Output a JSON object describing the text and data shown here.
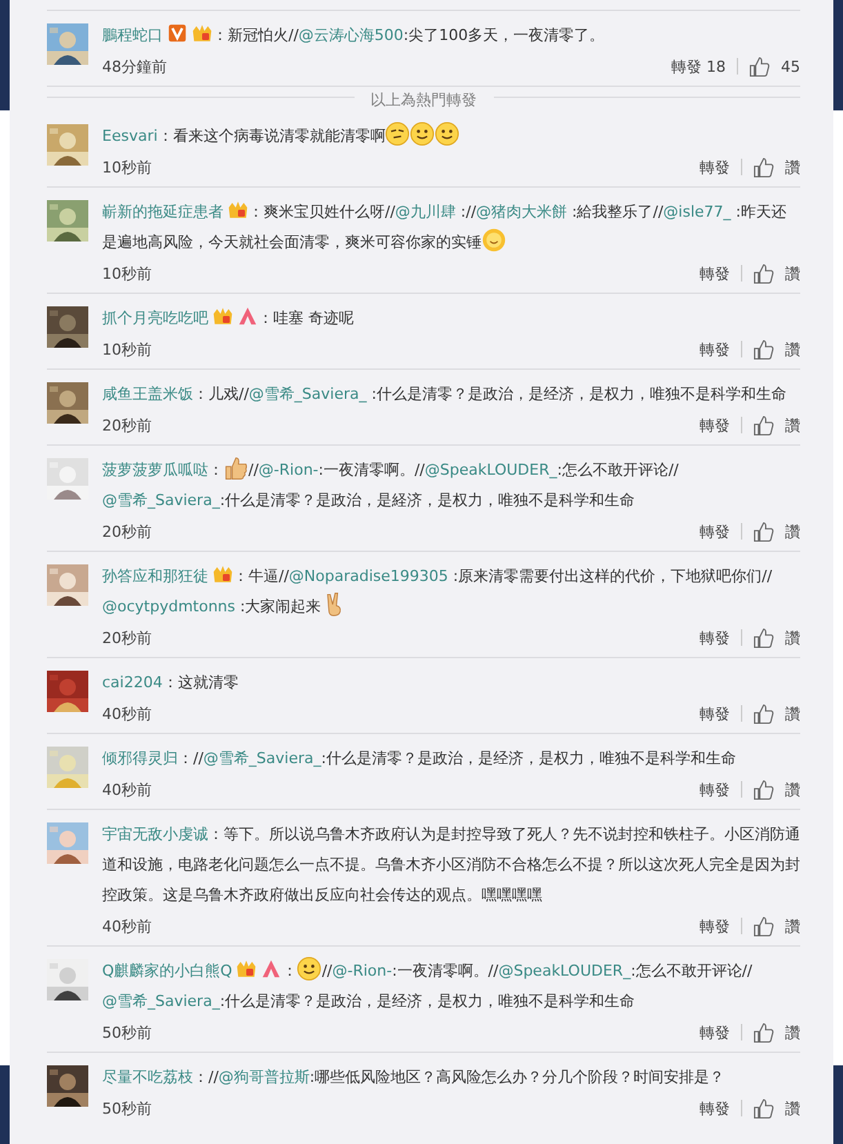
{
  "hot_posts": [
    {
      "name": "鵬程蛇口",
      "verified": true,
      "crown": true,
      "peak": false,
      "segments": [
        {
          "kind": "text",
          "text": "：新冠怕火//"
        },
        {
          "kind": "mention",
          "text": "@云涛心海500"
        },
        {
          "kind": "text",
          "text": ":尖了100多天，一夜清零了。"
        }
      ],
      "time": "48分鐘前",
      "repost": "轉發",
      "repost_count": "18",
      "like": "45"
    }
  ],
  "hot_divider": "以上為熱門轉發",
  "posts": [
    {
      "name": "Eesvari",
      "verified": false,
      "crown": false,
      "peak": false,
      "segments": [
        {
          "kind": "text",
          "text": "：看来这个病毒说清零就能清零啊"
        },
        {
          "kind": "smirk"
        },
        {
          "kind": "smiley"
        },
        {
          "kind": "smiley"
        }
      ],
      "time": "10秒前",
      "repost": "轉發",
      "like": "讚"
    },
    {
      "name": "嶄新的拖延症患者",
      "verified": false,
      "crown": true,
      "peak": false,
      "segments": [
        {
          "kind": "text",
          "text": "：爽米宝贝姓什么呀//"
        },
        {
          "kind": "mention",
          "text": "@九川肆"
        },
        {
          "kind": "text",
          "text": " ://"
        },
        {
          "kind": "mention",
          "text": "@猪肉大米餅"
        },
        {
          "kind": "text",
          "text": " :給我整乐了//"
        },
        {
          "kind": "mention",
          "text": "@isle77_"
        },
        {
          "kind": "text",
          "text": " :昨天还是遍地高风险，今天就社会面清零，爽米可容你家的实锤"
        },
        {
          "kind": "sun"
        }
      ],
      "time": "10秒前",
      "repost": "轉發",
      "like": "讚"
    },
    {
      "name": "抓个月亮吃吃吧",
      "verified": false,
      "crown": true,
      "peak": true,
      "segments": [
        {
          "kind": "text",
          "text": "：哇塞 奇迹呢"
        }
      ],
      "time": "10秒前",
      "repost": "轉發",
      "like": "讚"
    },
    {
      "name": "咸鱼王盖米饭",
      "verified": false,
      "crown": false,
      "peak": false,
      "segments": [
        {
          "kind": "text",
          "text": "：儿戏//"
        },
        {
          "kind": "mention",
          "text": "@雪希_Saviera_"
        },
        {
          "kind": "text",
          "text": " :什么是清零？是政治，是经济，是权力，唯独不是科学和生命"
        }
      ],
      "time": "20秒前",
      "repost": "轉發",
      "like": "讚"
    },
    {
      "name": "菠萝菠萝瓜呱哒",
      "verified": false,
      "crown": false,
      "peak": false,
      "segments": [
        {
          "kind": "text",
          "text": "："
        },
        {
          "kind": "thumbs"
        },
        {
          "kind": "text",
          "text": "//"
        },
        {
          "kind": "mention",
          "text": "@-Rion-"
        },
        {
          "kind": "text",
          "text": ":一夜清零啊。//"
        },
        {
          "kind": "mention",
          "text": "@SpeakLOUDER_"
        },
        {
          "kind": "text",
          "text": ":怎么不敢开评论//"
        },
        {
          "kind": "mention",
          "text": "@雪希_Saviera_"
        },
        {
          "kind": "text",
          "text": ":什么是清零？是政治，是経济，是权力，唯独不是科学和生命"
        }
      ],
      "time": "20秒前",
      "repost": "轉發",
      "like": "讚"
    },
    {
      "name": "孙答应和那狂徒",
      "verified": false,
      "crown": true,
      "peak": false,
      "segments": [
        {
          "kind": "text",
          "text": "：牛逼//"
        },
        {
          "kind": "mention",
          "text": "@Noparadise199305"
        },
        {
          "kind": "text",
          "text": " :原来清零需要付出这样的代价，下地狱吧你们//"
        },
        {
          "kind": "mention",
          "text": "@ocytpydmtonns"
        },
        {
          "kind": "text",
          "text": " :大家闹起来"
        },
        {
          "kind": "victory"
        }
      ],
      "time": "20秒前",
      "repost": "轉發",
      "like": "讚"
    },
    {
      "name": "cai2204",
      "verified": false,
      "crown": false,
      "peak": false,
      "segments": [
        {
          "kind": "text",
          "text": "：这就清零"
        }
      ],
      "time": "40秒前",
      "repost": "轉發",
      "like": "讚"
    },
    {
      "name": "倾邪得灵归",
      "verified": false,
      "crown": false,
      "peak": false,
      "segments": [
        {
          "kind": "text",
          "text": "：//"
        },
        {
          "kind": "mention",
          "text": "@雪希_Saviera_"
        },
        {
          "kind": "text",
          "text": ":什么是清零？是政治，是经济，是权力，唯独不是科学和生命"
        }
      ],
      "time": "40秒前",
      "repost": "轉發",
      "like": "讚"
    },
    {
      "name": "宇宙无敌小虔诚",
      "verified": false,
      "crown": false,
      "peak": false,
      "segments": [
        {
          "kind": "text",
          "text": "：等下。所以说乌鲁木齐政府认为是封控导致了死人？先不说封控和铁柱子。小区消防通道和设施，电路老化问题怎么一点不提。乌鲁木齐小区消防不合格怎么不提？所以这次死人完全是因为封控政策。这是乌鲁木齐政府做出反应向社会传达的观点。嘿嘿嘿嘿"
        }
      ],
      "time": "40秒前",
      "repost": "轉發",
      "like": "讚"
    },
    {
      "name": "Q麒麟家的小白熊Q",
      "verified": false,
      "crown": true,
      "peak": true,
      "segments": [
        {
          "kind": "text",
          "text": "："
        },
        {
          "kind": "smiley"
        },
        {
          "kind": "text",
          "text": "//"
        },
        {
          "kind": "mention",
          "text": "@-Rion-"
        },
        {
          "kind": "text",
          "text": ":一夜清零啊。//"
        },
        {
          "kind": "mention",
          "text": "@SpeakLOUDER_"
        },
        {
          "kind": "text",
          "text": ":怎么不敢开评论//"
        },
        {
          "kind": "mention",
          "text": "@雪希_Saviera_"
        },
        {
          "kind": "text",
          "text": ":什么是清零？是政治，是经济，是权力，唯独不是科学和生命"
        }
      ],
      "time": "50秒前",
      "repost": "轉發",
      "like": "讚"
    },
    {
      "name": "尽量不吃荔枝",
      "verified": false,
      "crown": false,
      "peak": false,
      "segments": [
        {
          "kind": "text",
          "text": "：//"
        },
        {
          "kind": "mention",
          "text": "@狗哥普拉斯"
        },
        {
          "kind": "text",
          "text": ":哪些低风险地区？高风险怎么办？分几个阶段？时间安排是？"
        }
      ],
      "time": "50秒前",
      "repost": "轉發",
      "like": "讚"
    }
  ]
}
